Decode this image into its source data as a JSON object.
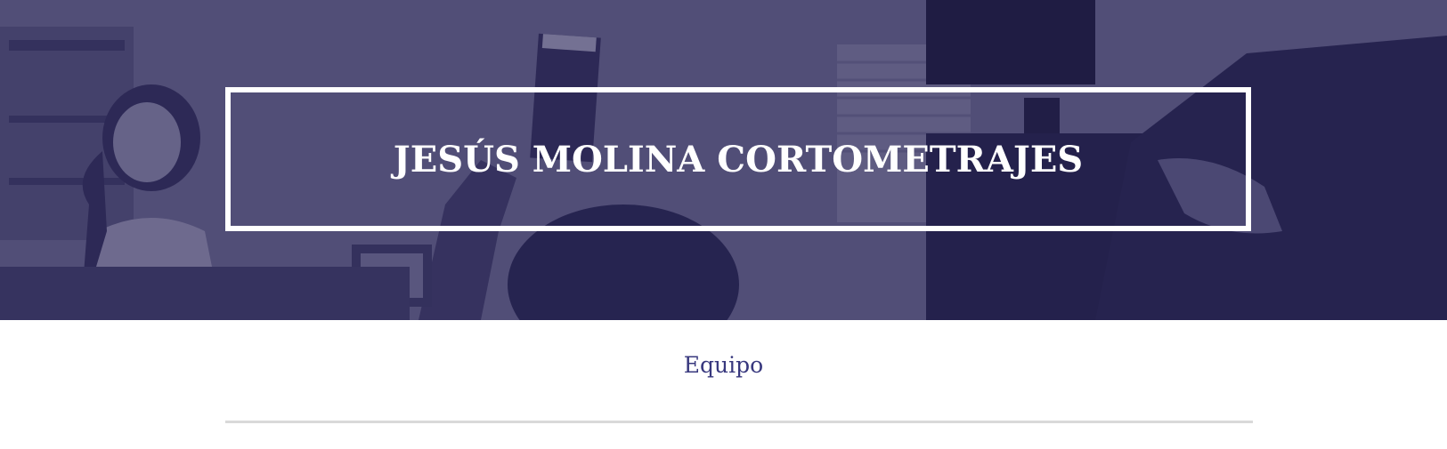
{
  "header": {
    "site_title": "JESÚS MOLINA CORTOMETRAJES",
    "background_image": "film-set-photo",
    "overlay_color": "#221f4e"
  },
  "nav": {
    "equipo_label": "Equipo",
    "link_color": "#38387e"
  }
}
